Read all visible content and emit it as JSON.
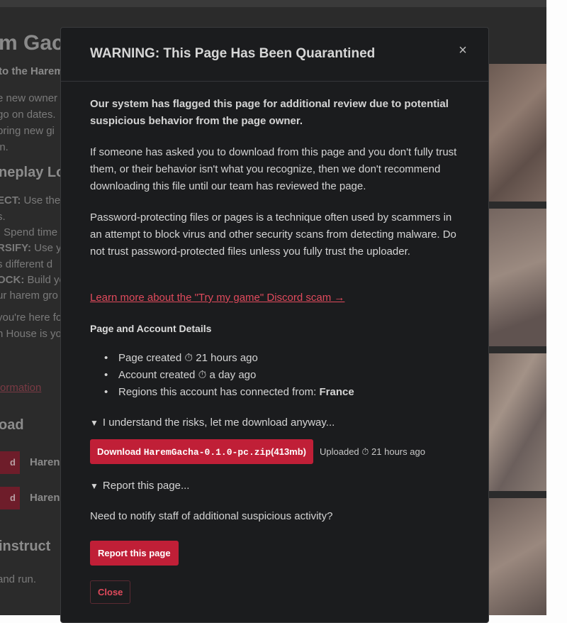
{
  "background": {
    "title": "m Gac",
    "subtitle": "to the Harem",
    "lines": [
      "e new owner",
      "go on dates.",
      "bring new gi",
      "in."
    ],
    "gameplay_heading": "neplay Loo",
    "loop_lines": [
      {
        "bold": "ECT:",
        "text": " Use the"
      },
      {
        "bold": "",
        "text": "s."
      },
      {
        "bold": ":",
        "text": " Spend time"
      },
      {
        "bold": "RSIFY:",
        "text": " Use y"
      },
      {
        "bold": "",
        "text": "s different d"
      },
      {
        "bold": "OCK:",
        "text": " Build yo"
      },
      {
        "bold": "",
        "text": "ur harem gro"
      }
    ],
    "outro_lines": [
      "you're here fo",
      "n House is yo"
    ],
    "info_link": "ormation",
    "download_heading": "oad",
    "download_buttons": [
      {
        "btn": "d",
        "label": "Haren"
      },
      {
        "btn": "d",
        "label": "Haren"
      }
    ],
    "instructions_heading": "instruct",
    "instructions_line": "and run."
  },
  "modal": {
    "title": "WARNING: This Page Has Been Quarantined",
    "close_icon": "×",
    "flagged_text": "Our system has flagged this page for additional review due to potential suspicious behavior from the page owner.",
    "paragraph1": "If someone has asked you to download from this page and you don't fully trust them, or their behavior isn't what you recognize, then we don't recommend downloading this file until our team has reviewed the page.",
    "paragraph2": "Password-protecting files or pages is a technique often used by scammers in an attempt to block virus and other security scans from detecting malware. Do not trust password-protected files unless you fully trust the uploader.",
    "scam_link": "Learn more about the \"Try my game\" Discord scam →",
    "details_title": "Page and Account Details",
    "details": {
      "page_created_label": "Page created",
      "page_created_value": "21 hours ago",
      "account_created_label": "Account created",
      "account_created_value": "a day ago",
      "regions_label": "Regions this account has connected from:",
      "regions_value": "France"
    },
    "timer_icon": "⏱",
    "download_summary": "I understand the risks, let me download anyway...",
    "download_button": {
      "prefix": "Download ",
      "filename": "HaremGacha-0.1.0-pc.zip",
      "size": "(413mb)"
    },
    "uploaded_label": "Uploaded",
    "uploaded_value": "21 hours ago",
    "report_summary": "Report this page...",
    "notify_text": "Need to notify staff of additional suspicious activity?",
    "report_button": "Report this page",
    "close_button": "Close",
    "accent_color": "#c01f37"
  }
}
